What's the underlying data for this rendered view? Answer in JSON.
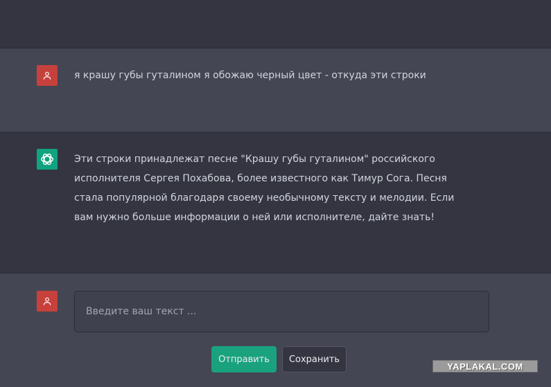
{
  "conversation": {
    "user_message": "я крашу губы гуталином я обожаю черный цвет - откуда эти строки",
    "bot_message": "Эти строки принадлежат песне \"Крашу губы гуталином\" российского исполнителя Сергея Похабова, более известного как Тимур Сога. Песня стала популярной благодаря своему необычному тексту и мелодии. Если вам нужно больше информации о ней или исполнителе, дайте знать!"
  },
  "input": {
    "placeholder": "Введите ваш текст ...",
    "value": ""
  },
  "buttons": {
    "send_label": "Отправить",
    "save_label": "Сохранить"
  },
  "watermark": "YAPLAKAL.COM",
  "colors": {
    "user_avatar": "#c7413c",
    "bot_avatar": "#10a37f",
    "send_button": "#19a27d",
    "background": "#343541",
    "alt_background": "#444654"
  },
  "icons": {
    "user_avatar": "user-icon",
    "bot_avatar": "openai-logo-icon"
  }
}
